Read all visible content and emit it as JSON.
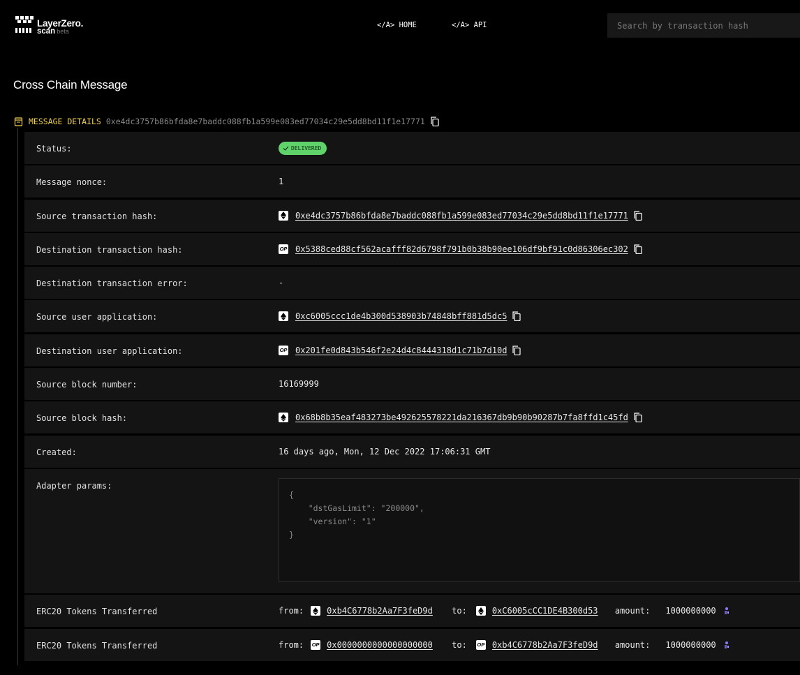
{
  "header": {
    "logo_name": "LayerZero.",
    "logo_sub": "scan",
    "logo_beta": "beta",
    "nav": [
      {
        "label": "</A> HOME"
      },
      {
        "label": "</A> API"
      }
    ],
    "search_placeholder": "Search by transaction hash"
  },
  "page_title": "Cross Chain Message",
  "section": {
    "label": "MESSAGE DETAILS",
    "hash": "0xe4dc3757b86bfda8e7baddc088fb1a599e083ed77034c29e5dd8bd11f1e17771"
  },
  "rows": {
    "status": {
      "label": "Status:",
      "value": "DELIVERED"
    },
    "nonce": {
      "label": "Message nonce:",
      "value": "1"
    },
    "src_tx": {
      "label": "Source transaction hash:",
      "chain": "ethereum-icon",
      "value": "0xe4dc3757b86bfda8e7baddc088fb1a599e083ed77034c29e5dd8bd11f1e17771"
    },
    "dst_tx": {
      "label": "Destination transaction hash:",
      "chain": "optimism-icon",
      "chain_text": "OP",
      "value": "0x5388ced88cf562acafff82d6798f791b0b38b90ee106df9bf91c0d86306ec302"
    },
    "dst_err": {
      "label": "Destination transaction error:",
      "value": "-"
    },
    "src_ua": {
      "label": "Source user application:",
      "chain": "ethereum-icon",
      "value": "0xc6005ccc1de4b300d538903b74848bff881d5dc5"
    },
    "dst_ua": {
      "label": "Destination user application:",
      "chain": "optimism-icon",
      "chain_text": "OP",
      "value": "0x201fe0d843b546f2e24d4c8444318d1c71b7d10d"
    },
    "src_block": {
      "label": "Source block number:",
      "value": "16169999"
    },
    "src_block_hash": {
      "label": "Source block hash:",
      "chain": "ethereum-icon",
      "value": "0x68b8b35eaf483273be492625578221da216367db9b90b90287b7fa8ffd1c45fd"
    },
    "created": {
      "label": "Created:",
      "value": "16 days ago, Mon, 12 Dec 2022 17:06:31 GMT"
    },
    "adapter": {
      "label": "Adapter params:",
      "code_lines": [
        "{",
        "    \"dstGasLimit\": \"200000\",",
        "    \"version\": \"1\"",
        "}"
      ]
    }
  },
  "transfers": [
    {
      "label": "ERC20 Tokens Transferred",
      "from_label": "from:",
      "from_chain": "ethereum-icon",
      "from": "0xb4C6778b2Aa7F3feD9d",
      "to_label": "to:",
      "to_chain": "ethereum-icon",
      "to": "0xC6005cCC1DE4B300d53",
      "amount_label": "amount:",
      "amount": "1000000000",
      "token_icon": "token-icon"
    },
    {
      "label": "ERC20 Tokens Transferred",
      "from_label": "from:",
      "from_chain": "optimism-icon",
      "from_chain_text": "OP",
      "from": "0x0000000000000000000",
      "to_label": "to:",
      "to_chain": "optimism-icon",
      "to_chain_text": "OP",
      "to": "0xb4C6778b2Aa7F3feD9d",
      "amount_label": "amount:",
      "amount": "1000000000",
      "token_icon": "token-icon"
    }
  ],
  "colors": {
    "background": "#000000",
    "row": "#141414",
    "accent_yellow": "#f3d34a",
    "delivered_green": "#5fd36a"
  }
}
